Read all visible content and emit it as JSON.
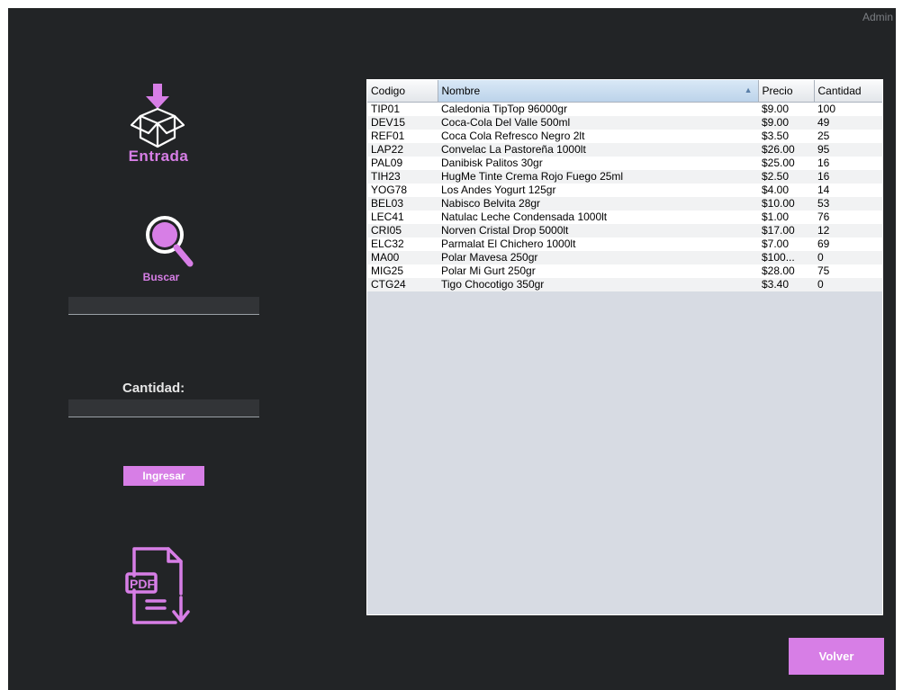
{
  "header": {
    "user": "Admin"
  },
  "sidebar": {
    "entrada_label": "Entrada",
    "buscar_label": "Buscar",
    "search_value": "",
    "cantidad_label": "Cantidad:",
    "cantidad_value": "",
    "ingresar_label": "Ingresar",
    "entrada_icon": "box-arrow-in-icon",
    "search_icon": "magnifier-icon",
    "pdf_icon": "pdf-export-icon",
    "accent_color": "#d77ee6"
  },
  "table": {
    "columns": [
      "Codigo",
      "Nombre",
      "Precio",
      "Cantidad"
    ],
    "sorted_column": "Nombre",
    "sort_direction": "ascending",
    "rows": [
      [
        "TIP01",
        "Caledonia TipTop 96000gr",
        "$9.00",
        "100"
      ],
      [
        "DEV15",
        "Coca-Cola Del Valle 500ml",
        "$9.00",
        "49"
      ],
      [
        "REF01",
        "Coca Cola Refresco Negro 2lt",
        "$3.50",
        "25"
      ],
      [
        "LAP22",
        "Convelac La Pastoreña 1000lt",
        "$26.00",
        "95"
      ],
      [
        "PAL09",
        "Danibisk Palitos 30gr",
        "$25.00",
        "16"
      ],
      [
        "TIH23",
        "HugMe Tinte Crema Rojo Fuego 25ml",
        "$2.50",
        "16"
      ],
      [
        "YOG78",
        "Los Andes Yogurt 125gr",
        "$4.00",
        "14"
      ],
      [
        "BEL03",
        "Nabisco Belvita 28gr",
        "$10.00",
        "53"
      ],
      [
        "LEC41",
        "Natulac Leche Condensada 1000lt",
        "$1.00",
        "76"
      ],
      [
        "CRI05",
        "Norven Cristal Drop 5000lt",
        "$17.00",
        "12"
      ],
      [
        "ELC32",
        "Parmalat El Chichero 1000lt",
        "$7.00",
        "69"
      ],
      [
        "MA00",
        "Polar Mavesa 250gr",
        "$100...",
        "0"
      ],
      [
        "MIG25",
        "Polar Mi Gurt 250gr",
        "$28.00",
        "75"
      ],
      [
        "CTG24",
        "Tigo Chocotigo 350gr",
        "$3.40",
        "0"
      ]
    ]
  },
  "footer": {
    "volver_label": "Volver"
  }
}
